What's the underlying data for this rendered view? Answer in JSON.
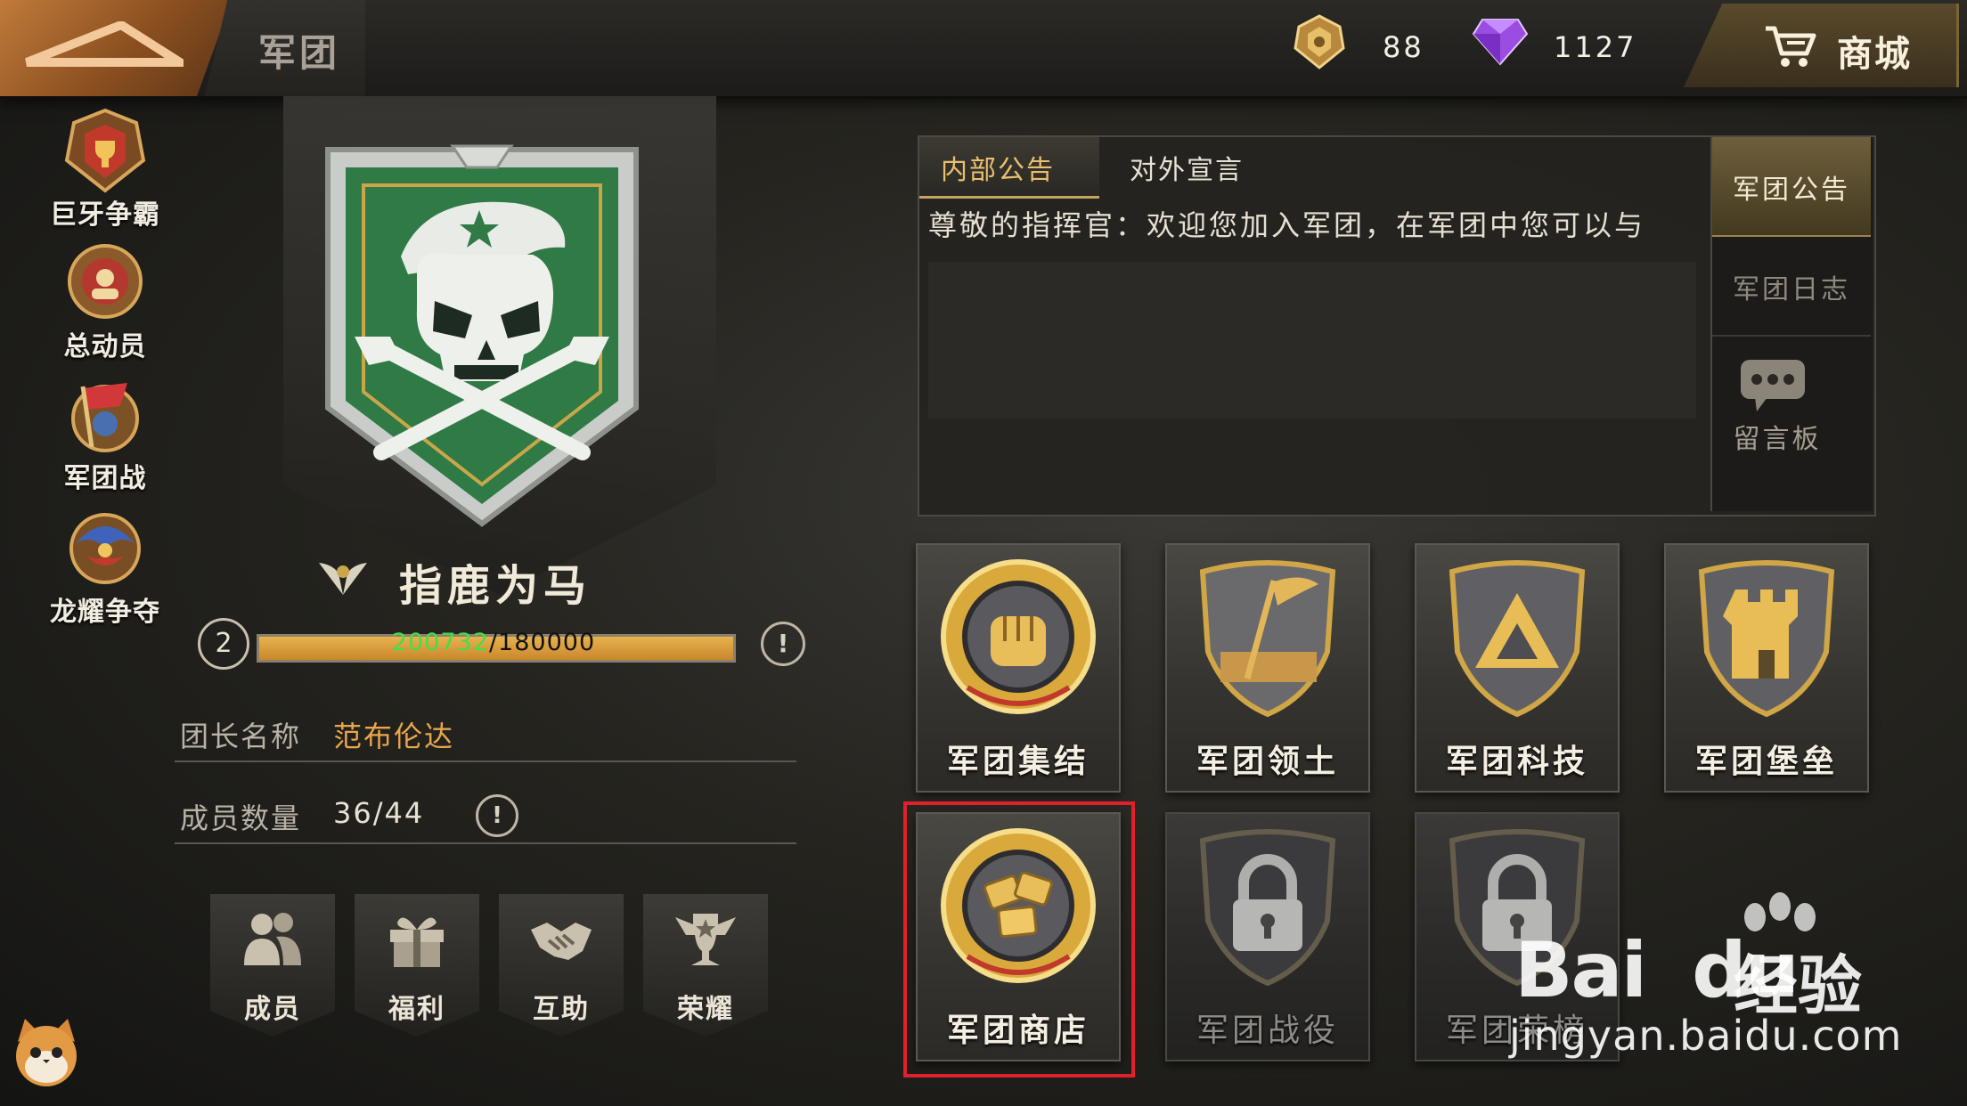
{
  "header": {
    "title": "军团",
    "gold_amount": "88",
    "gem_amount": "1127",
    "shop_label": "商城"
  },
  "side_events": [
    {
      "label": "巨牙争霸",
      "icon": "trophy-badge-icon"
    },
    {
      "label": "总动员",
      "icon": "mobilization-badge-icon"
    },
    {
      "label": "军团战",
      "icon": "legion-war-badge-icon"
    },
    {
      "label": "龙耀争夺",
      "icon": "dragon-badge-icon"
    }
  ],
  "legion": {
    "name": "指鹿为马",
    "level": "2",
    "exp_current": "200732",
    "exp_separator": "/",
    "exp_max": "180000",
    "exp_fill_ratio": 1.0,
    "leader_key": "团长名称",
    "leader_value": "范布伦达",
    "members_key": "成员数量",
    "members_value": "36/44",
    "info_glyph": "!"
  },
  "quick_actions": [
    {
      "label": "成员",
      "icon": "members-icon"
    },
    {
      "label": "福利",
      "icon": "gift-icon"
    },
    {
      "label": "互助",
      "icon": "handshake-icon"
    },
    {
      "label": "荣耀",
      "icon": "trophy-icon"
    }
  ],
  "notice": {
    "tab_internal": "内部公告",
    "tab_external": "对外宣言",
    "text": "尊敬的指挥官：欢迎您加入军团，在军团中您可以与"
  },
  "side_tabs": {
    "notice": "军团公告",
    "log": "军团日志",
    "message_board": "留言板"
  },
  "features": [
    {
      "label": "军团集结",
      "icon": "fist-medal-icon",
      "locked": false
    },
    {
      "label": "军团领土",
      "icon": "flag-shield-icon",
      "locked": false
    },
    {
      "label": "军团科技",
      "icon": "triangle-shield-icon",
      "locked": false
    },
    {
      "label": "军团堡垒",
      "icon": "tower-shield-icon",
      "locked": false
    },
    {
      "label": "军团商店",
      "icon": "coins-medal-icon",
      "locked": false
    },
    {
      "label": "军团战役",
      "icon": "padlock-icon",
      "locked": true
    },
    {
      "label": "军团荣榜",
      "icon": "padlock-icon",
      "locked": true
    }
  ],
  "watermark": {
    "brand": "Bai",
    "brand2": "du",
    "cn": "经验",
    "url": "jingyan.baidu.com"
  },
  "colors": {
    "accent_gold": "#e9c06d",
    "exp_green": "#3fe04a",
    "highlight_red": "#e0202a"
  }
}
